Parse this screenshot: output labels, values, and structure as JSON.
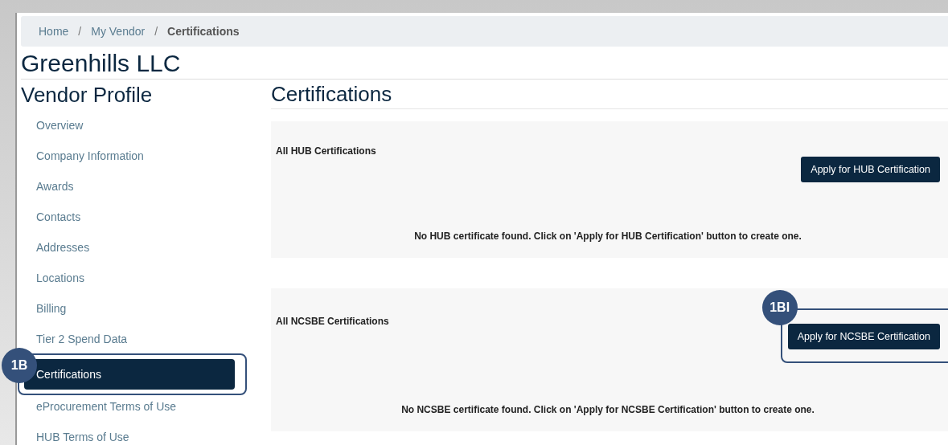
{
  "breadcrumb": [
    {
      "label": "Home",
      "current": false
    },
    {
      "label": "My Vendor",
      "current": false
    },
    {
      "label": "Certifications",
      "current": true
    }
  ],
  "separator": "/",
  "company": "Greenhills LLC",
  "sidebar": {
    "title": "Vendor Profile",
    "items": [
      {
        "label": "Overview",
        "selected": false
      },
      {
        "label": "Company Information",
        "selected": false
      },
      {
        "label": "Awards",
        "selected": false
      },
      {
        "label": "Contacts",
        "selected": false
      },
      {
        "label": "Addresses",
        "selected": false
      },
      {
        "label": "Locations",
        "selected": false
      },
      {
        "label": "Billing",
        "selected": false
      },
      {
        "label": "Tier 2 Spend Data",
        "selected": false
      },
      {
        "label": "Certifications",
        "selected": true,
        "callout": "1B"
      },
      {
        "label": "eProcurement Terms of Use",
        "selected": false
      },
      {
        "label": "HUB Terms of Use",
        "selected": false
      }
    ]
  },
  "main": {
    "title": "Certifications",
    "sections": [
      {
        "title": "All HUB Certifications",
        "button": "Apply for HUB Certification",
        "message": "No HUB certificate found. Click on 'Apply for HUB Certification' button to create one."
      },
      {
        "title": "All NCSBE Certifications",
        "button": "Apply for NCSBE Certification",
        "callout": "1BI",
        "message": "No NCSBE certificate found. Click on 'Apply for NCSBE Certification' button to create one."
      }
    ]
  }
}
